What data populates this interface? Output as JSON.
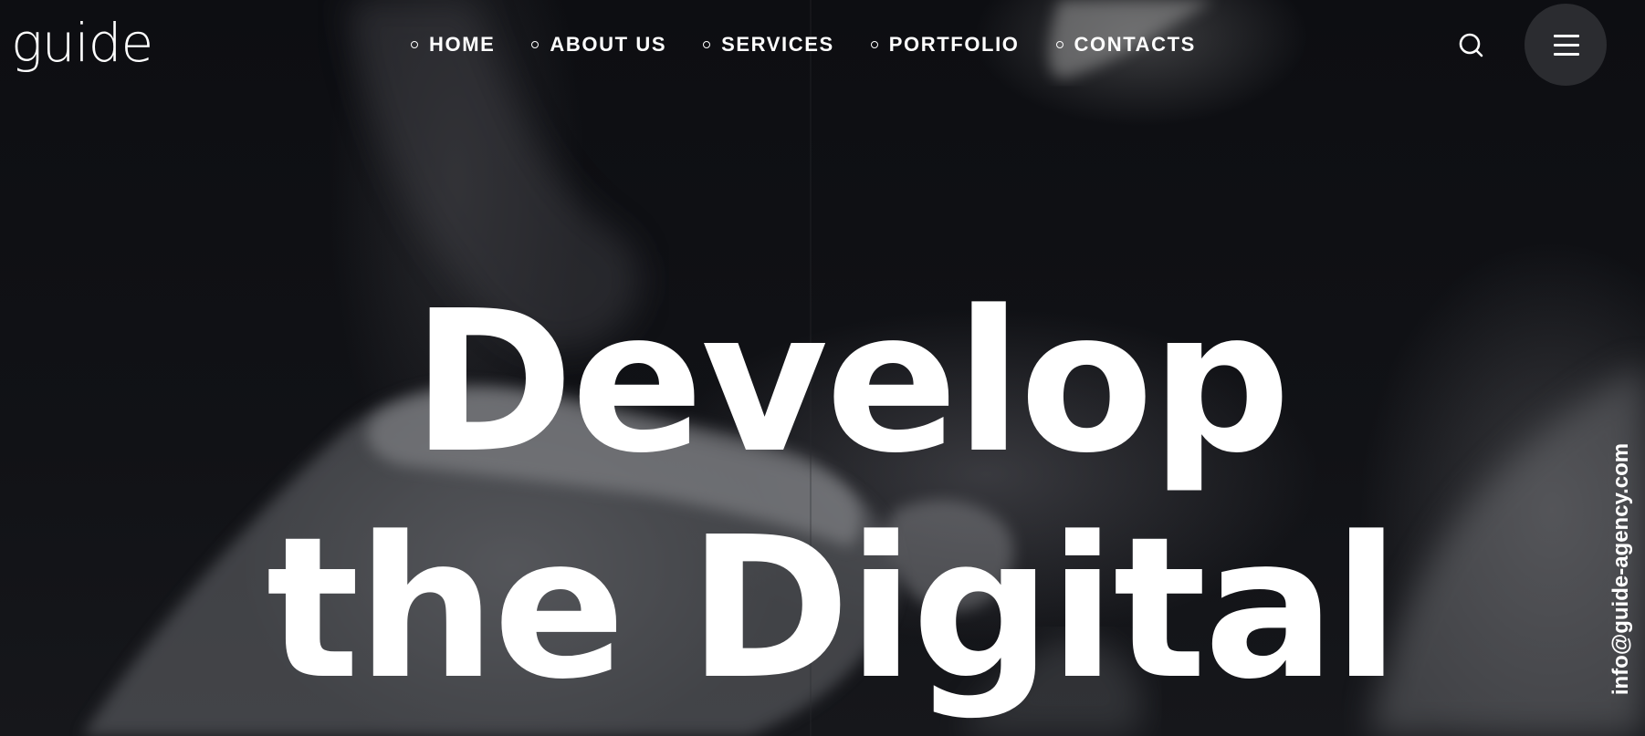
{
  "brand": {
    "logo_text": "guide"
  },
  "nav": {
    "items": [
      {
        "label": "HOME"
      },
      {
        "label": "ABOUT US"
      },
      {
        "label": "SERVICES"
      },
      {
        "label": "PORTFOLIO"
      },
      {
        "label": "CONTACTS"
      }
    ]
  },
  "header": {
    "search_icon": "search-icon",
    "menu_icon": "hamburger-menu-icon"
  },
  "hero": {
    "headline_line1": "Develop",
    "headline_line2": "the Digital"
  },
  "sidebar": {
    "email": "info@guide-agency.com"
  },
  "colors": {
    "background": "#0c0d10",
    "text": "#ffffff",
    "menu_button": "#2b2c30"
  }
}
